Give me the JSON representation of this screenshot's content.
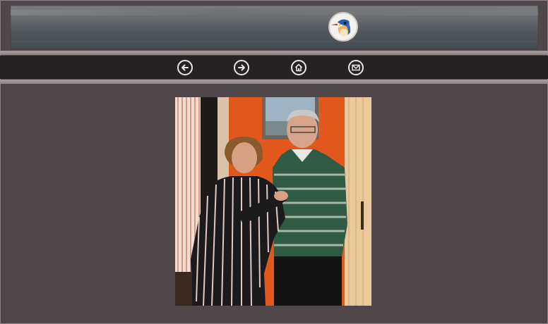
{
  "header": {
    "logo_icon": "kingfisher-logo"
  },
  "nav": {
    "buttons": [
      {
        "icon": "arrow-left-icon"
      },
      {
        "icon": "arrow-right-icon"
      },
      {
        "icon": "home-icon"
      },
      {
        "icon": "mail-icon"
      }
    ],
    "icon_color": "#e9e6e6",
    "bar_color": "#262223"
  },
  "page": {
    "background_color": "#4f4749",
    "accent_band_color": "#a79c9d"
  },
  "photo": {
    "subject": "photo-elderly-couple"
  }
}
